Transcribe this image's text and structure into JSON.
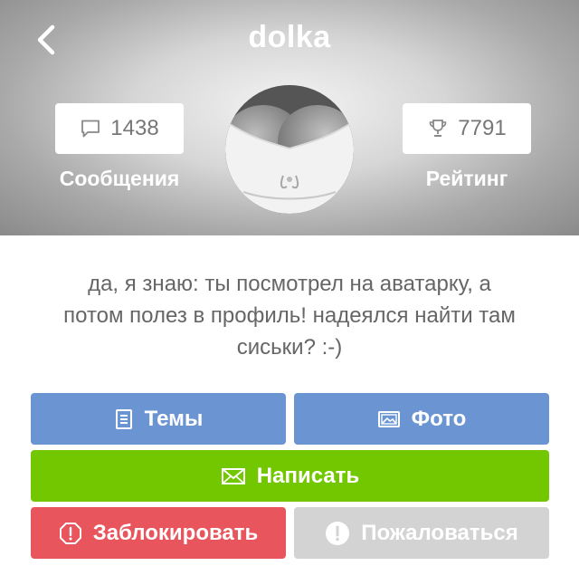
{
  "header": {
    "title": "dolka",
    "messages": {
      "count": "1438",
      "label": "Сообщения",
      "icon": "speech-bubble-icon"
    },
    "rating": {
      "count": "7791",
      "label": "Рейтинг",
      "icon": "trophy-icon"
    }
  },
  "bio": {
    "line1": "да, я знаю: ты посмотрел на аватарку, а",
    "line2": "потом полез в профиль! надеялся найти там",
    "line3": "сиськи? :-)"
  },
  "buttons": {
    "topics": {
      "label": "Темы",
      "icon": "document-icon",
      "color": "#6b95d2"
    },
    "photo": {
      "label": "Фото",
      "icon": "image-icon",
      "color": "#6b95d2"
    },
    "write": {
      "label": "Написать",
      "icon": "envelope-icon",
      "color": "#72c700"
    },
    "block": {
      "label": "Заблокировать",
      "icon": "block-icon",
      "color": "#e8555d"
    },
    "report": {
      "label": "Пожаловаться",
      "icon": "exclamation-icon",
      "color": "#d3d3d3"
    }
  }
}
